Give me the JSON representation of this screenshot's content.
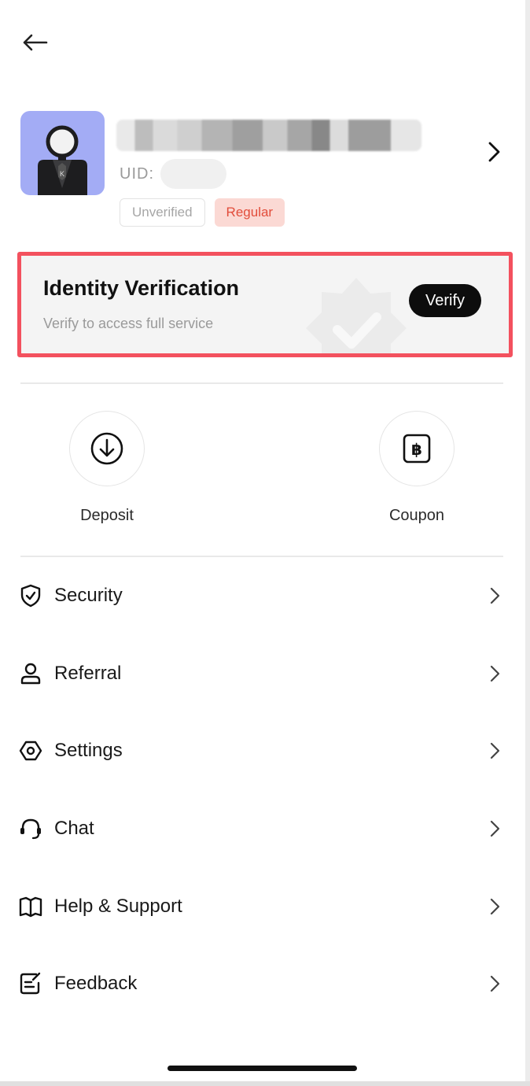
{
  "header": {
    "back_icon": "arrow-left-icon"
  },
  "profile": {
    "uid_label": "UID:",
    "tags": {
      "unverified": "Unverified",
      "regular": "Regular"
    }
  },
  "identity_card": {
    "title": "Identity Verification",
    "subtitle": "Verify to access full service",
    "button_label": "Verify",
    "highlight_color": "#f3515e"
  },
  "quick_actions": [
    {
      "label": "Deposit",
      "icon": "download-circle-icon"
    },
    {
      "label": "Coupon",
      "icon": "bitcoin-coupon-icon"
    }
  ],
  "menu": [
    {
      "label": "Security",
      "icon": "shield-check-icon"
    },
    {
      "label": "Referral",
      "icon": "user-icon"
    },
    {
      "label": "Settings",
      "icon": "hexagon-settings-icon"
    },
    {
      "label": "Chat",
      "icon": "headset-icon"
    },
    {
      "label": "Help & Support",
      "icon": "book-icon"
    },
    {
      "label": "Feedback",
      "icon": "feedback-edit-icon"
    }
  ],
  "colors": {
    "avatar_bg": "#a3acf5",
    "tag_regular_bg": "#fbd9d4",
    "tag_regular_text": "#e24d3b",
    "verify_button_bg": "#0d0d0d"
  }
}
